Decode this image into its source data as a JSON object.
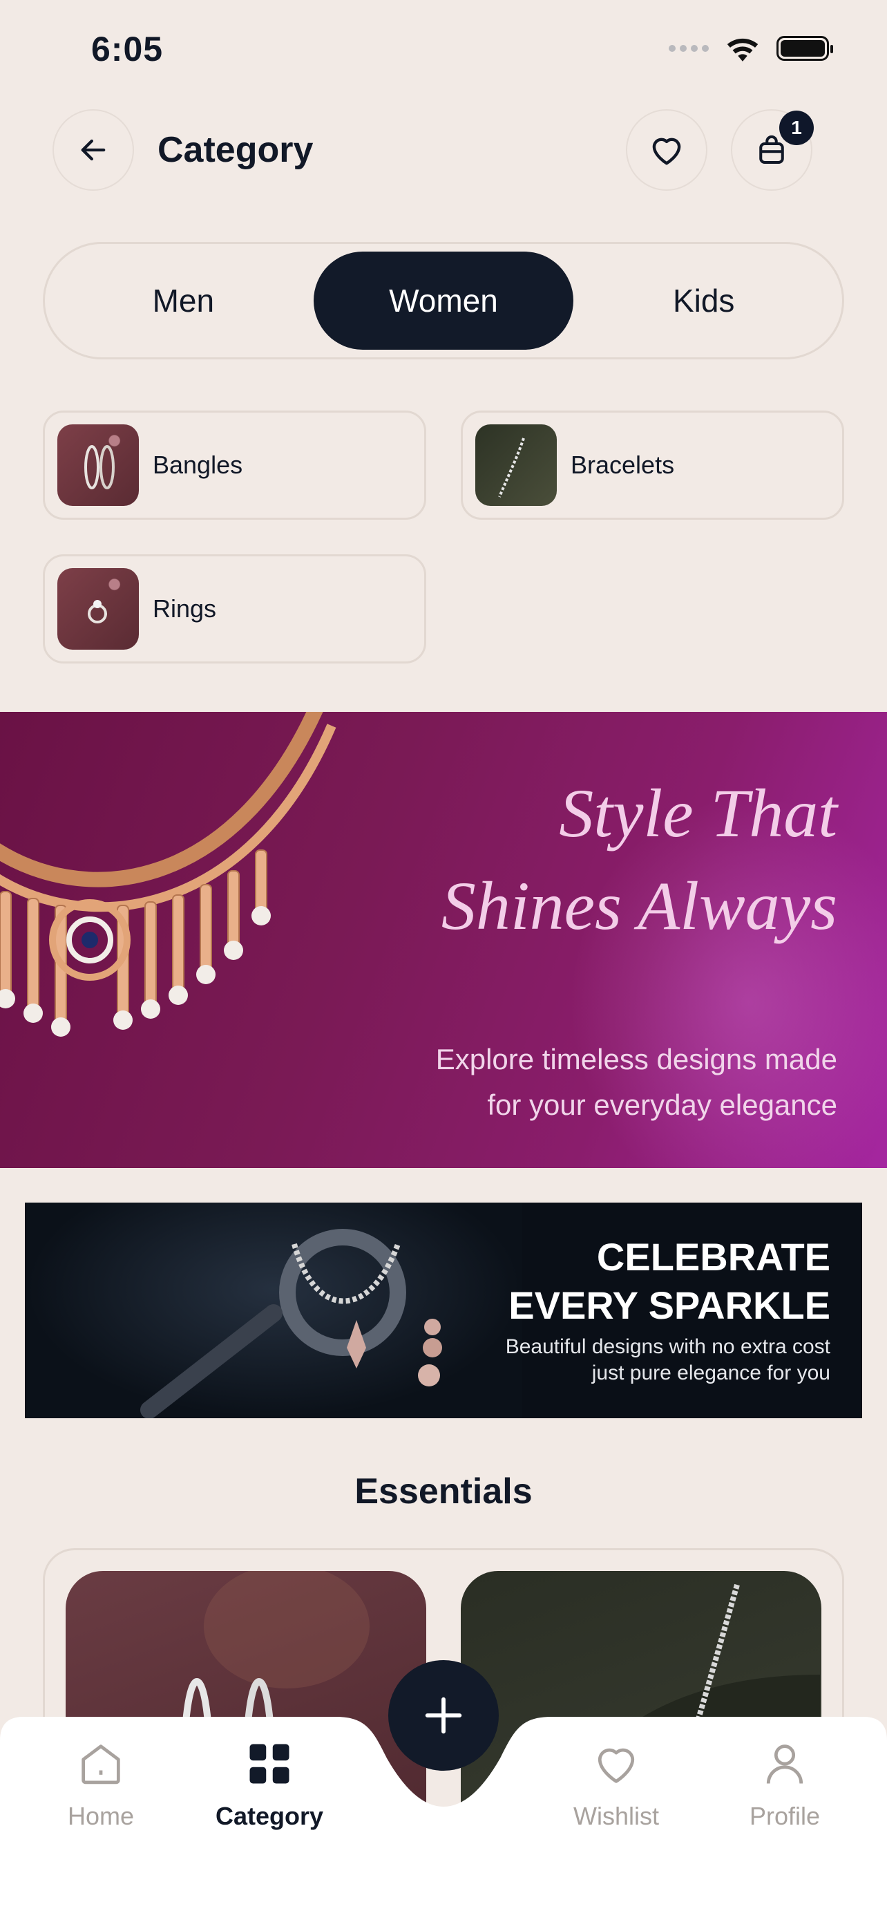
{
  "status_bar": {
    "time": "6:05"
  },
  "header": {
    "title": "Category",
    "cart_count": "1"
  },
  "tabs": [
    {
      "label": "Men",
      "active": false
    },
    {
      "label": "Women",
      "active": true
    },
    {
      "label": "Kids",
      "active": false
    }
  ],
  "categories": [
    {
      "label": "Bangles",
      "thumb": "bangles-thumb"
    },
    {
      "label": "Bracelets",
      "thumb": "bracelets-thumb"
    },
    {
      "label": "Rings",
      "thumb": "rings-thumb"
    }
  ],
  "hero": {
    "title_line1": "Style That",
    "title_line2": "Shines Always",
    "sub_line1": "Explore timeless designs made",
    "sub_line2": "for your everyday elegance"
  },
  "promo": {
    "title_line1": "CELEBRATE",
    "title_line2": "EVERY SPARKLE",
    "sub_line1": "Beautiful designs with no extra cost",
    "sub_line2": "just pure elegance for you"
  },
  "section": {
    "title": "Essentials"
  },
  "nav": {
    "home": "Home",
    "category": "Category",
    "wishlist": "Wishlist",
    "profile": "Profile"
  },
  "colors": {
    "background": "#F2EAE5",
    "primary": "#121A29",
    "hero": "#7A1A55"
  }
}
